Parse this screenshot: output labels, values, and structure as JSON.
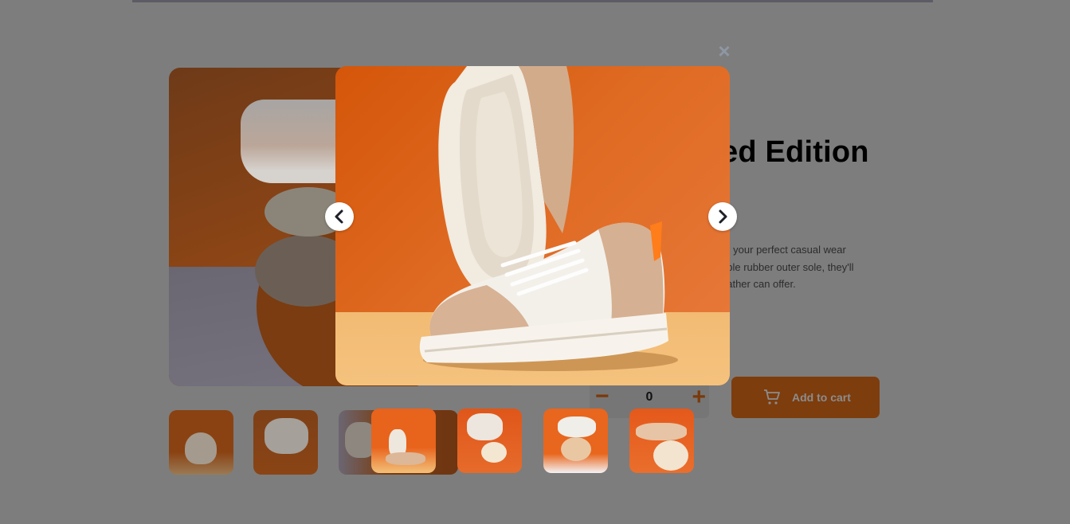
{
  "product": {
    "title_fragment": "ed Edition",
    "description_fragment": "re your perfect casual wear\nable rubber outer sole, they'll\neather can offer.",
    "quantity": "0",
    "minus_symbol": "−",
    "plus_symbol": "+",
    "add_to_cart_label": "Add to cart"
  },
  "lightbox": {
    "close_symbol": "×",
    "prev_label": "<",
    "next_label": ">"
  },
  "colors": {
    "accent_orange": "#ff7d1a",
    "overlay": "#7d7d7d",
    "close_icon": "#8e97a3"
  },
  "icons": [
    "close-icon",
    "chevron-left-icon",
    "chevron-right-icon",
    "cart-icon",
    "minus-icon",
    "plus-icon"
  ]
}
